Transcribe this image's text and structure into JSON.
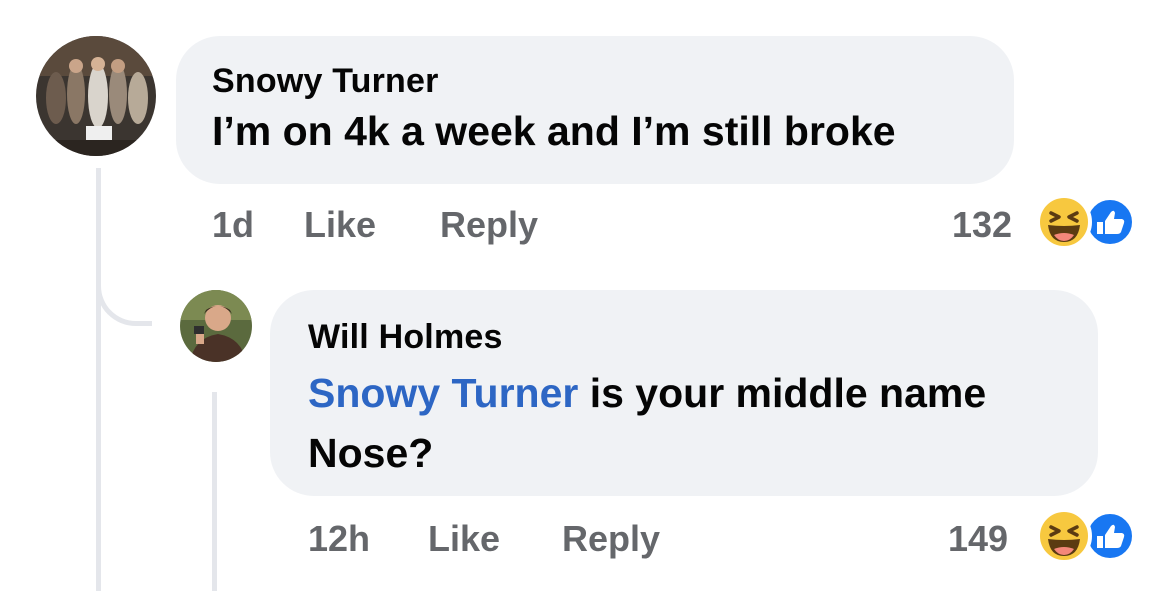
{
  "comments": [
    {
      "author": "Snowy Turner",
      "text": "I’m on 4k a week and I’m still broke",
      "time": "1d",
      "like_label": "Like",
      "reply_label": "Reply",
      "reaction_count": "132",
      "reactions": [
        "haha-icon",
        "like-icon"
      ]
    },
    {
      "author": "Will Holmes",
      "mention": "Snowy Turner",
      "text_line1": " is your middle name",
      "text_line2": "Nose?",
      "time": "12h",
      "like_label": "Like",
      "reply_label": "Reply",
      "reaction_count": "149",
      "reactions": [
        "haha-icon",
        "like-icon"
      ]
    }
  ],
  "colors": {
    "bubble": "#f0f2f5",
    "mention": "#2d66c4",
    "meta": "#65676b",
    "like_blue": "#1877f2",
    "haha_yellow": "#f7c83f"
  }
}
